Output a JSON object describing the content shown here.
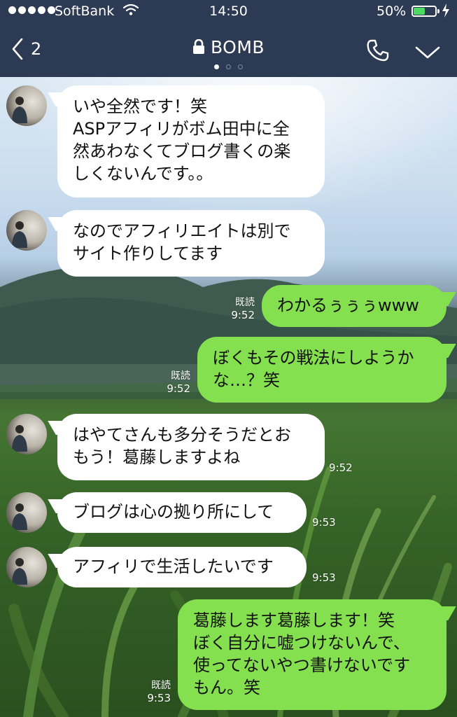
{
  "status_bar": {
    "carrier": "SoftBank",
    "time": "14:50",
    "battery_percent": "50%",
    "battery_level": 0.5,
    "signal_bars": 5,
    "icons": [
      "wifi-icon",
      "battery-icon",
      "charging-bolt-icon"
    ]
  },
  "header": {
    "back_count": "2",
    "title": "BOMB",
    "page_dots": 3,
    "active_page": 0,
    "icons": [
      "chevron-left-icon",
      "lock-icon",
      "phone-icon",
      "chevron-down-icon"
    ]
  },
  "colors": {
    "header_bg": "#2d3a53",
    "outgoing_bubble": "#84e04f",
    "incoming_bubble": "#ffffff",
    "battery_fill": "#4cd964"
  },
  "messages": [
    {
      "direction": "in",
      "text": "いや全然です！笑\nASPアフィリがボム田中に全\n然あわなくてブログ書くの楽\nしくないんです。。",
      "read": "",
      "time": ""
    },
    {
      "direction": "in",
      "text": "なのでアフィリエイトは別で\nサイト作りしてます",
      "read": "",
      "time": ""
    },
    {
      "direction": "out",
      "text": "わかるぅぅぅwww",
      "read": "既読",
      "time": "9:52"
    },
    {
      "direction": "out",
      "text": "ぼくもその戦法にしようか\nな…？笑",
      "read": "既読",
      "time": "9:52"
    },
    {
      "direction": "in",
      "text": "はやてさんも多分そうだとお\nもう！葛藤しますよね",
      "read": "",
      "time": "9:52"
    },
    {
      "direction": "in",
      "text": "ブログは心の拠り所にして",
      "read": "",
      "time": "9:53"
    },
    {
      "direction": "in",
      "text": "アフィリで生活したいです",
      "read": "",
      "time": "9:53"
    },
    {
      "direction": "out",
      "text": "葛藤します葛藤します！笑\nぼく自分に嘘つけないんで、\n使ってないやつ書けないです\nもん。笑",
      "read": "既読",
      "time": "9:53"
    }
  ]
}
